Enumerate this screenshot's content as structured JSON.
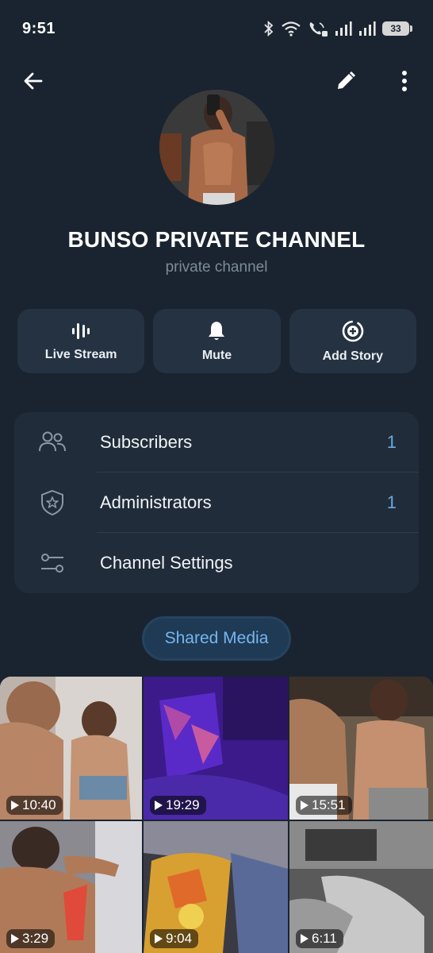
{
  "status": {
    "time": "9:51",
    "battery": "33"
  },
  "channel": {
    "title": "BUNSO PRIVATE CHANNEL",
    "subtitle": "private channel"
  },
  "actions": [
    {
      "label": "Live Stream",
      "icon": "live-stream-icon"
    },
    {
      "label": "Mute",
      "icon": "bell-icon"
    },
    {
      "label": "Add Story",
      "icon": "add-story-icon"
    }
  ],
  "menu": [
    {
      "label": "Subscribers",
      "value": "1",
      "icon": "people-icon"
    },
    {
      "label": "Administrators",
      "value": "1",
      "icon": "shield-star-icon"
    },
    {
      "label": "Channel Settings",
      "value": "",
      "icon": "settings-sliders-icon"
    }
  ],
  "shared_media": {
    "label": "Shared Media"
  },
  "media": [
    {
      "duration": "10:40"
    },
    {
      "duration": "19:29"
    },
    {
      "duration": "15:51"
    },
    {
      "duration": "3:29"
    },
    {
      "duration": "9:04"
    },
    {
      "duration": "6:11"
    }
  ],
  "colors": {
    "background": "#1a2430",
    "card": "#202c39",
    "accent": "#6aa8de"
  }
}
